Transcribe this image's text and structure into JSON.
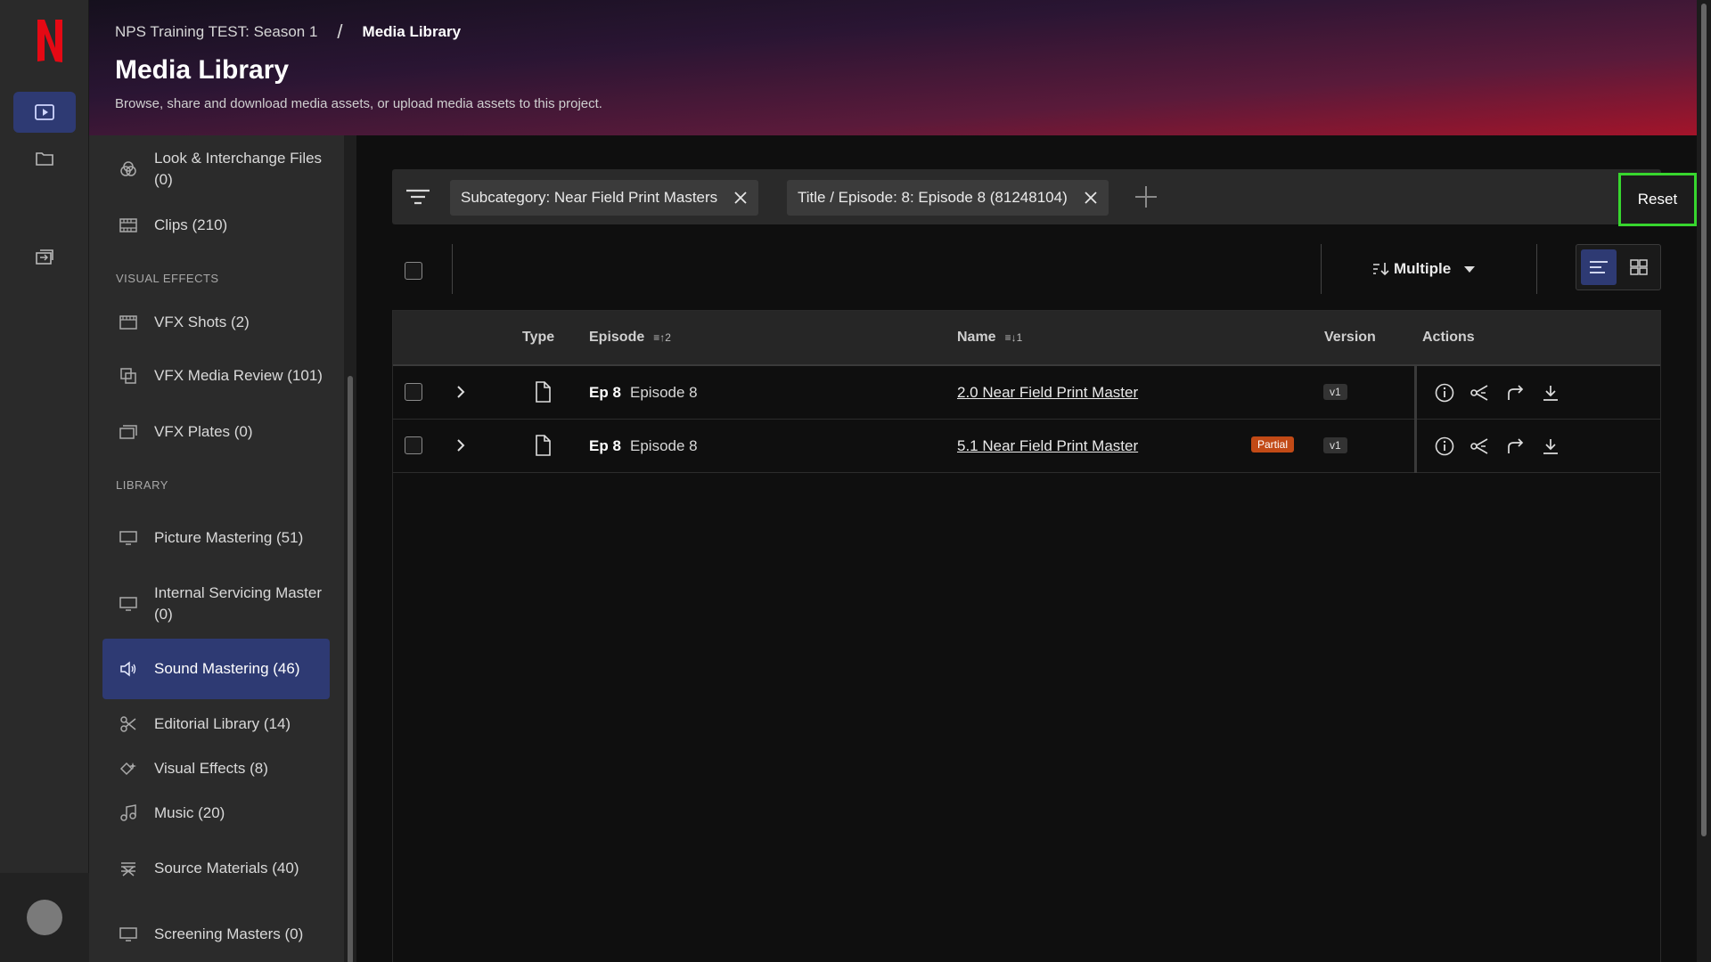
{
  "header": {
    "breadcrumb_project": "NPS Training TEST: Season 1",
    "breadcrumb_sep": "/",
    "breadcrumb_current": "Media Library",
    "title": "Media Library",
    "subtitle": "Browse, share and download media assets, or upload media assets to this project."
  },
  "brand": {
    "logo_letter": "N",
    "accent": "#e50914",
    "active_bg": "#2e3a73",
    "highlight": "#37d62e"
  },
  "sidebar": {
    "items_top": [
      {
        "label": "Look & Interchange Files (0)",
        "icon": "look-interchange-icon"
      },
      {
        "label": "Clips (210)",
        "icon": "film-icon"
      }
    ],
    "section_vfx": "VISUAL EFFECTS",
    "items_vfx": [
      {
        "label": "VFX Shots (2)",
        "icon": "film-strip-icon"
      },
      {
        "label": "VFX Media Review (101)",
        "icon": "review-icon"
      },
      {
        "label": "VFX Plates (0)",
        "icon": "plates-icon"
      }
    ],
    "section_library": "LIBRARY",
    "items_library": [
      {
        "label": "Picture Mastering (51)",
        "icon": "monitor-icon"
      },
      {
        "label": "Internal Servicing Master (0)",
        "icon": "monitor-icon"
      },
      {
        "label": "Sound Mastering (46)",
        "icon": "speaker-icon",
        "active": true
      },
      {
        "label": "Editorial Library (14)",
        "icon": "scissors-icon"
      },
      {
        "label": "Visual Effects (8)",
        "icon": "sparkle-icon"
      },
      {
        "label": "Music (20)",
        "icon": "music-icon"
      },
      {
        "label": "Source Materials (40)",
        "icon": "director-chair-icon"
      },
      {
        "label": "Screening Masters (0)",
        "icon": "monitor-icon"
      }
    ]
  },
  "filters": {
    "chips": [
      "Subcategory: Near Field Print Masters",
      "Title / Episode: 8: Episode 8 (81248104)"
    ],
    "reset_label": "Reset"
  },
  "toolbar": {
    "sort_label": "Multiple",
    "view_modes": [
      "list",
      "grid"
    ],
    "selected_view": "list"
  },
  "table": {
    "columns": {
      "type": "Type",
      "episode": "Episode",
      "episode_sort_index": "2",
      "name": "Name",
      "name_sort_index": "1",
      "version": "Version",
      "actions": "Actions"
    },
    "rows": [
      {
        "ep": "Ep 8",
        "episode_title": "Episode 8",
        "name": "2.0 Near Field Print Master",
        "badge": "",
        "version": "v1"
      },
      {
        "ep": "Ep 8",
        "episode_title": "Episode 8",
        "name": "5.1 Near Field Print Master",
        "badge": "Partial",
        "version": "v1"
      }
    ],
    "row_actions": [
      "info-icon",
      "share-icon",
      "forward-icon",
      "download-icon"
    ]
  }
}
